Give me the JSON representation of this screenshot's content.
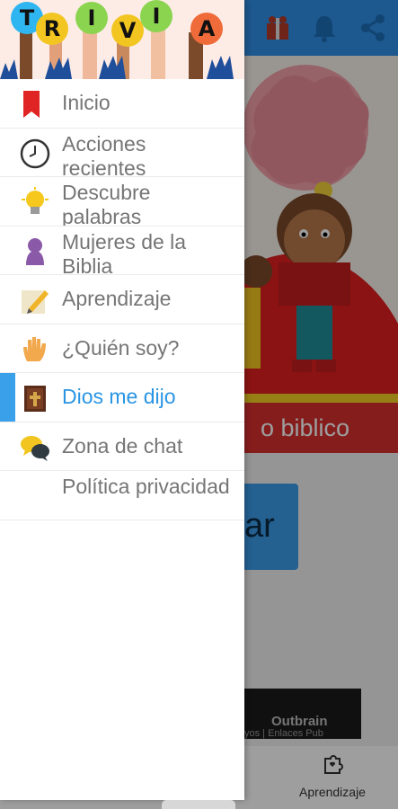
{
  "header": {
    "logo_letters": [
      "T",
      "R",
      "I",
      "V",
      "I",
      "A"
    ],
    "logo_colors": [
      "#2fb5f0",
      "#f2c521",
      "#8bd450",
      "#f2c521",
      "#8bd450",
      "#f06b3a"
    ]
  },
  "drawer": {
    "items": [
      {
        "label": "Inicio",
        "icon": "bookmark-icon"
      },
      {
        "label": "Acciones recientes",
        "icon": "clock-icon"
      },
      {
        "label": "Descubre palabras",
        "icon": "lightbulb-icon"
      },
      {
        "label": "Mujeres de la Biblia",
        "icon": "woman-icon"
      },
      {
        "label": "Aprendizaje",
        "icon": "pencil-icon"
      },
      {
        "label": "¿Quién soy?",
        "icon": "hand-icon"
      },
      {
        "label": "Dios me dijo",
        "icon": "bible-icon",
        "active": true
      },
      {
        "label": "Zona de chat",
        "icon": "chat-bubbles-icon"
      },
      {
        "label": "Política privacidad",
        "icon": ""
      }
    ],
    "active_color": "#2a95e4"
  },
  "background": {
    "banner_text": "o biblico",
    "button_text": "ar",
    "ad_brand": "Outbrain",
    "ad_sub": "yos | Enlaces Pub",
    "bottom_nav_label": "Aprendizaje"
  },
  "colors": {
    "topbar": "#2f8fe6",
    "banner": "#d93030",
    "button": "#3a9be8"
  }
}
